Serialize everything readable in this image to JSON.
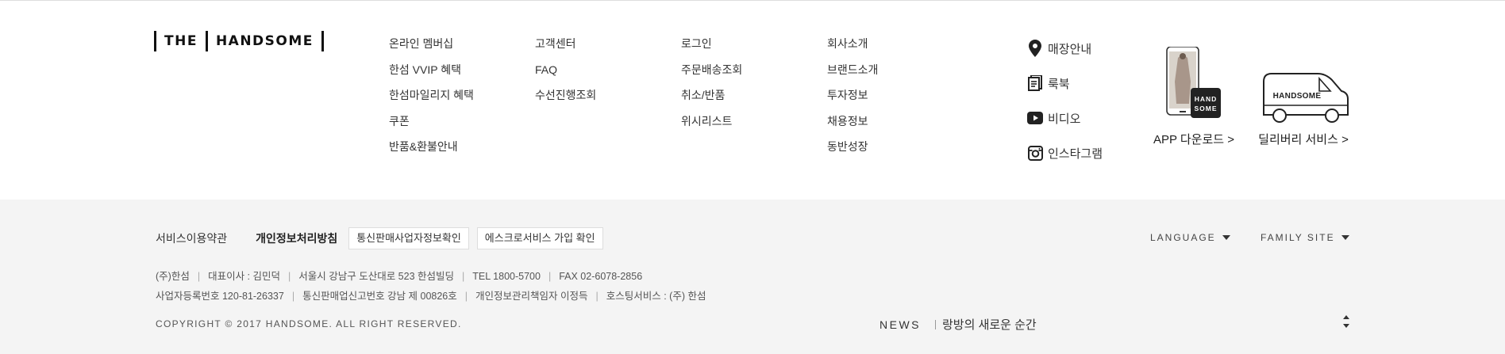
{
  "logo": {
    "left_text": "THE",
    "right_text": "HANDSOME"
  },
  "menu": {
    "col1": [
      "온라인 멤버십",
      "한섬 VVIP 혜택",
      "한섬마일리지 혜택",
      "쿠폰",
      "반품&환불안내"
    ],
    "col2": [
      "고객센터",
      "FAQ",
      "수선진행조회"
    ],
    "col3": [
      "로그인",
      "주문배송조회",
      "취소/반품",
      "위시리스트"
    ],
    "col4": [
      "회사소개",
      "브랜드소개",
      "투자정보",
      "채용정보",
      "동반성장"
    ]
  },
  "social": [
    {
      "icon": "location-pin-icon",
      "label": "매장안내"
    },
    {
      "icon": "lookbook-icon",
      "label": "룩북"
    },
    {
      "icon": "youtube-icon",
      "label": "비디오"
    },
    {
      "icon": "instagram-icon",
      "label": "인스타그램"
    }
  ],
  "app": {
    "label": "APP 다운로드 >",
    "badge_line1": "HAND",
    "badge_line2": "SOME"
  },
  "delivery": {
    "label": "딜리버리 서비스 >",
    "van_text": "HANDSOME"
  },
  "bottom": {
    "terms": "서비스이용약관",
    "privacy": "개인정보처리방침",
    "business_info_button": "통신판매사업자정보확인",
    "escrow_button": "에스크로서비스 가입 확인",
    "language": "LANGUAGE",
    "family_site": "FAMILY SITE",
    "info_line1": [
      "(주)한섬",
      "대표이사 : 김민덕",
      "서울시 강남구 도산대로 523 한섬빌딩",
      "TEL 1800-5700",
      "FAX 02-6078-2856"
    ],
    "info_line2": [
      "사업자등록번호 120-81-26337",
      "통신판매업신고번호 강남 제 00826호",
      "개인정보관리책임자 이정득",
      "호스팅서비스 : (주) 한섬"
    ],
    "copyright": "COPYRIGHT © 2017 HANDSOME. ALL RIGHT RESERVED.",
    "news_label": "NEWS",
    "news_text": "랑방의 새로운 순간"
  }
}
